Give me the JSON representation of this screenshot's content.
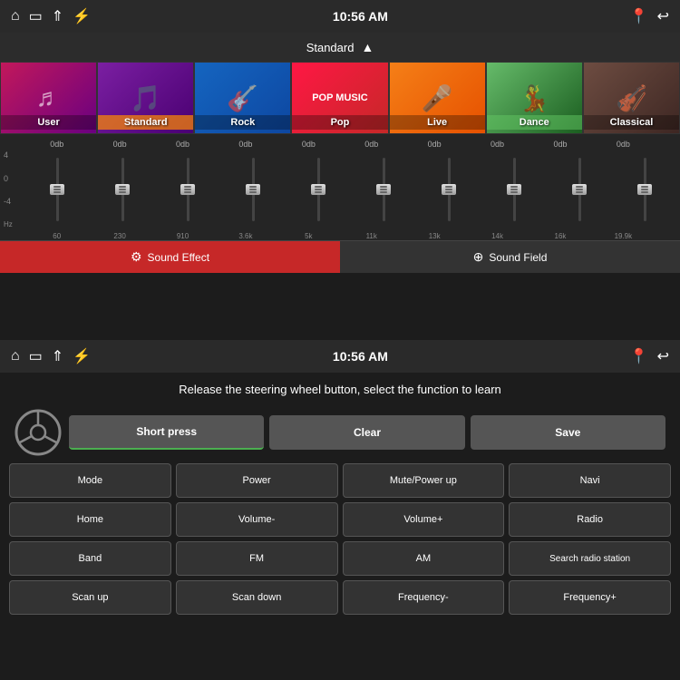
{
  "topPanel": {
    "statusBar": {
      "time": "10:56 AM",
      "icons": [
        "home",
        "screen",
        "up-arrow",
        "usb"
      ]
    },
    "presetBar": {
      "label": "Standard",
      "chevron": "▲"
    },
    "presets": [
      {
        "id": "user",
        "name": "User",
        "style": "user"
      },
      {
        "id": "standard",
        "name": "Standard",
        "style": "standard",
        "active": true
      },
      {
        "id": "rock",
        "name": "Rock",
        "style": "rock"
      },
      {
        "id": "pop",
        "name": "Pop",
        "style": "pop"
      },
      {
        "id": "live",
        "name": "Live",
        "style": "live"
      },
      {
        "id": "dance",
        "name": "Dance",
        "style": "dance"
      },
      {
        "id": "classical",
        "name": "Classical",
        "style": "classical"
      }
    ],
    "equalizer": {
      "dbLabels": [
        "0db",
        "0db",
        "0db",
        "0db",
        "0db",
        "0db",
        "0db",
        "0db",
        "0db",
        "0db"
      ],
      "axisTop": "4",
      "axisMiddle": "0",
      "axisBottom": "-4",
      "axisHz": "Hz",
      "freqLabels": [
        "60",
        "230",
        "910",
        "3.6k",
        "5k",
        "11k",
        "13k",
        "14k",
        "16k",
        "19.9k"
      ]
    },
    "tabs": [
      {
        "id": "sound-effect",
        "label": "Sound Effect",
        "active": true
      },
      {
        "id": "sound-field",
        "label": "Sound Field",
        "active": false
      }
    ]
  },
  "bottomPanel": {
    "statusBar": {
      "time": "10:56 AM"
    },
    "instructionText": "Release the steering wheel button, select the function to learn",
    "actions": {
      "shortPress": "Short press",
      "clear": "Clear",
      "save": "Save"
    },
    "functionButtons": [
      {
        "id": "mode",
        "label": "Mode"
      },
      {
        "id": "power",
        "label": "Power"
      },
      {
        "id": "mute-power-up",
        "label": "Mute/Power up"
      },
      {
        "id": "navi",
        "label": "Navi"
      },
      {
        "id": "home",
        "label": "Home"
      },
      {
        "id": "volume-minus",
        "label": "Volume-"
      },
      {
        "id": "volume-plus",
        "label": "Volume+"
      },
      {
        "id": "radio",
        "label": "Radio"
      },
      {
        "id": "band",
        "label": "Band"
      },
      {
        "id": "fm",
        "label": "FM"
      },
      {
        "id": "am",
        "label": "AM"
      },
      {
        "id": "search-radio-station",
        "label": "Search radio station"
      },
      {
        "id": "scan-up",
        "label": "Scan up"
      },
      {
        "id": "scan-down",
        "label": "Scan down"
      },
      {
        "id": "frequency-minus",
        "label": "Frequency-"
      },
      {
        "id": "frequency-plus",
        "label": "Frequency+"
      }
    ]
  }
}
